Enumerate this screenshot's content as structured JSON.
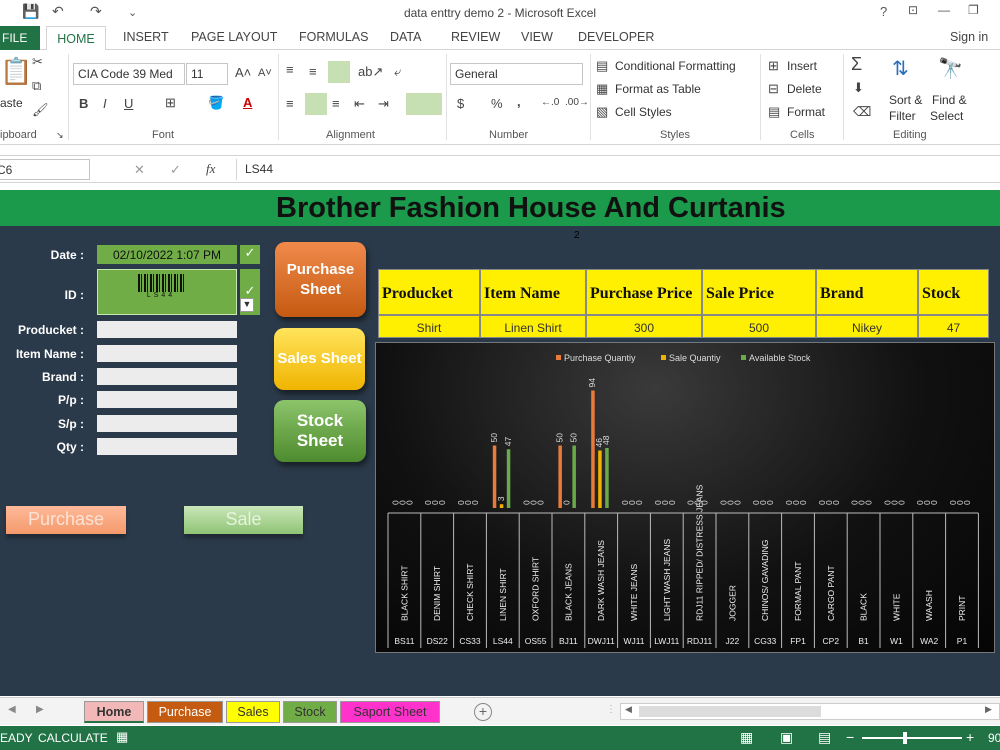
{
  "window": {
    "title": "data enttry demo 2 - Microsoft Excel",
    "help": "?",
    "sign_in": "Sign in"
  },
  "ribbon_tabs": [
    "FILE",
    "HOME",
    "INSERT",
    "PAGE LAYOUT",
    "FORMULAS",
    "DATA",
    "REVIEW",
    "VIEW",
    "DEVELOPER"
  ],
  "ribbon": {
    "clipboard": {
      "paste": "aste",
      "label": "ipboard"
    },
    "font": {
      "name": "CIA Code 39 Med",
      "size": "11",
      "label": "Font",
      "bold": "B",
      "italic": "I",
      "underline": "U"
    },
    "alignment": {
      "label": "Alignment"
    },
    "number": {
      "format": "General",
      "label": "Number",
      "currency": "$",
      "percent": "%",
      "comma": ","
    },
    "styles": {
      "conditional": "Conditional Formatting",
      "format_table": "Format as Table",
      "cell_styles": "Cell Styles",
      "label": "Styles"
    },
    "cells": {
      "insert": "Insert",
      "delete": "Delete",
      "format": "Format",
      "label": "Cells"
    },
    "editing": {
      "sort1": "Sort &",
      "sort2": "Filter",
      "find1": "Find &",
      "find2": "Select",
      "label": "Editing"
    }
  },
  "formula_bar": {
    "name_box": "C6",
    "fx": "fx",
    "content": "LS44"
  },
  "sheet": {
    "banner": "Brother Fashion House And Curtanis",
    "small_num": "2",
    "form": {
      "labels": [
        "Date :",
        "ID :",
        "Producket :",
        "Item Name :",
        "Brand :",
        "P/p :",
        "S/p :",
        "Qty :"
      ],
      "date_value": "02/10/2022 1:07 PM",
      "barcode_text": "LS44"
    },
    "buttons": {
      "purchase_sheet": "Purchase Sheet",
      "sales_sheet": "Sales Sheet",
      "stock_sheet": "Stock Sheet",
      "purchase": "Purchase",
      "sale": "Sale"
    },
    "table": {
      "headers": [
        "Producket",
        "Item Name",
        "Purchase Price",
        "Sale Price",
        "Brand",
        "Stock"
      ],
      "row": [
        "Shirt",
        "Linen Shirt",
        "300",
        "500",
        "Nikey",
        "47"
      ]
    }
  },
  "chart_data": {
    "type": "bar",
    "legend_position": "top",
    "series": [
      {
        "name": "Purchase Quantiy",
        "color": "#e87b3a",
        "values": [
          0,
          0,
          0,
          50,
          0,
          50,
          94,
          0,
          0,
          0,
          0,
          0,
          0,
          0,
          0,
          0,
          0,
          0
        ]
      },
      {
        "name": "Sale Quantiy",
        "color": "#f0b400",
        "values": [
          0,
          0,
          0,
          3,
          0,
          0,
          46,
          0,
          0,
          0,
          0,
          0,
          0,
          0,
          0,
          0,
          0,
          0
        ]
      },
      {
        "name": "Available Stock",
        "color": "#6aaa4a",
        "values": [
          0,
          0,
          0,
          47,
          0,
          50,
          48,
          0,
          0,
          0,
          0,
          0,
          0,
          0,
          0,
          0,
          0,
          0
        ]
      }
    ],
    "categories": [
      "BLACK SHIRT",
      "DENIM SHIRT",
      "CHECK SHIRT",
      "LINEN SHIRT",
      "OXFORD SHIRT",
      "BLACK JEANS",
      "DARK WASH JEANS",
      "WHITE JEANS",
      "LIGHT WASH JEANS",
      "RDJ11 RIPPED/ DISTRESS JEANS",
      "JOGGER",
      "CHINOS/ GAVADING",
      "FORMAL PANT",
      "CARGO PANT",
      "BLACK",
      "WHITE",
      "WAASH",
      "PRINT"
    ],
    "codes": [
      "BS11",
      "DS22",
      "CS33",
      "LS44",
      "OS55",
      "BJ11",
      "DWJ11",
      "WJ11",
      "LWJ11",
      "RDJ11",
      "J22",
      "CG33",
      "FP1",
      "CP2",
      "B1",
      "W1",
      "WA2",
      "P1"
    ]
  },
  "sheet_tabs": [
    {
      "label": "Home",
      "color": "#f2b8b8"
    },
    {
      "label": "Purchase",
      "color": "#c55a11"
    },
    {
      "label": "Sales",
      "color": "#ffff00"
    },
    {
      "label": "Stock",
      "color": "#70ad47"
    },
    {
      "label": "Saport Sheet",
      "color": "#ff33cc"
    }
  ],
  "status": {
    "ready": "EADY",
    "calculate": "CALCULATE",
    "zoom": "90"
  }
}
